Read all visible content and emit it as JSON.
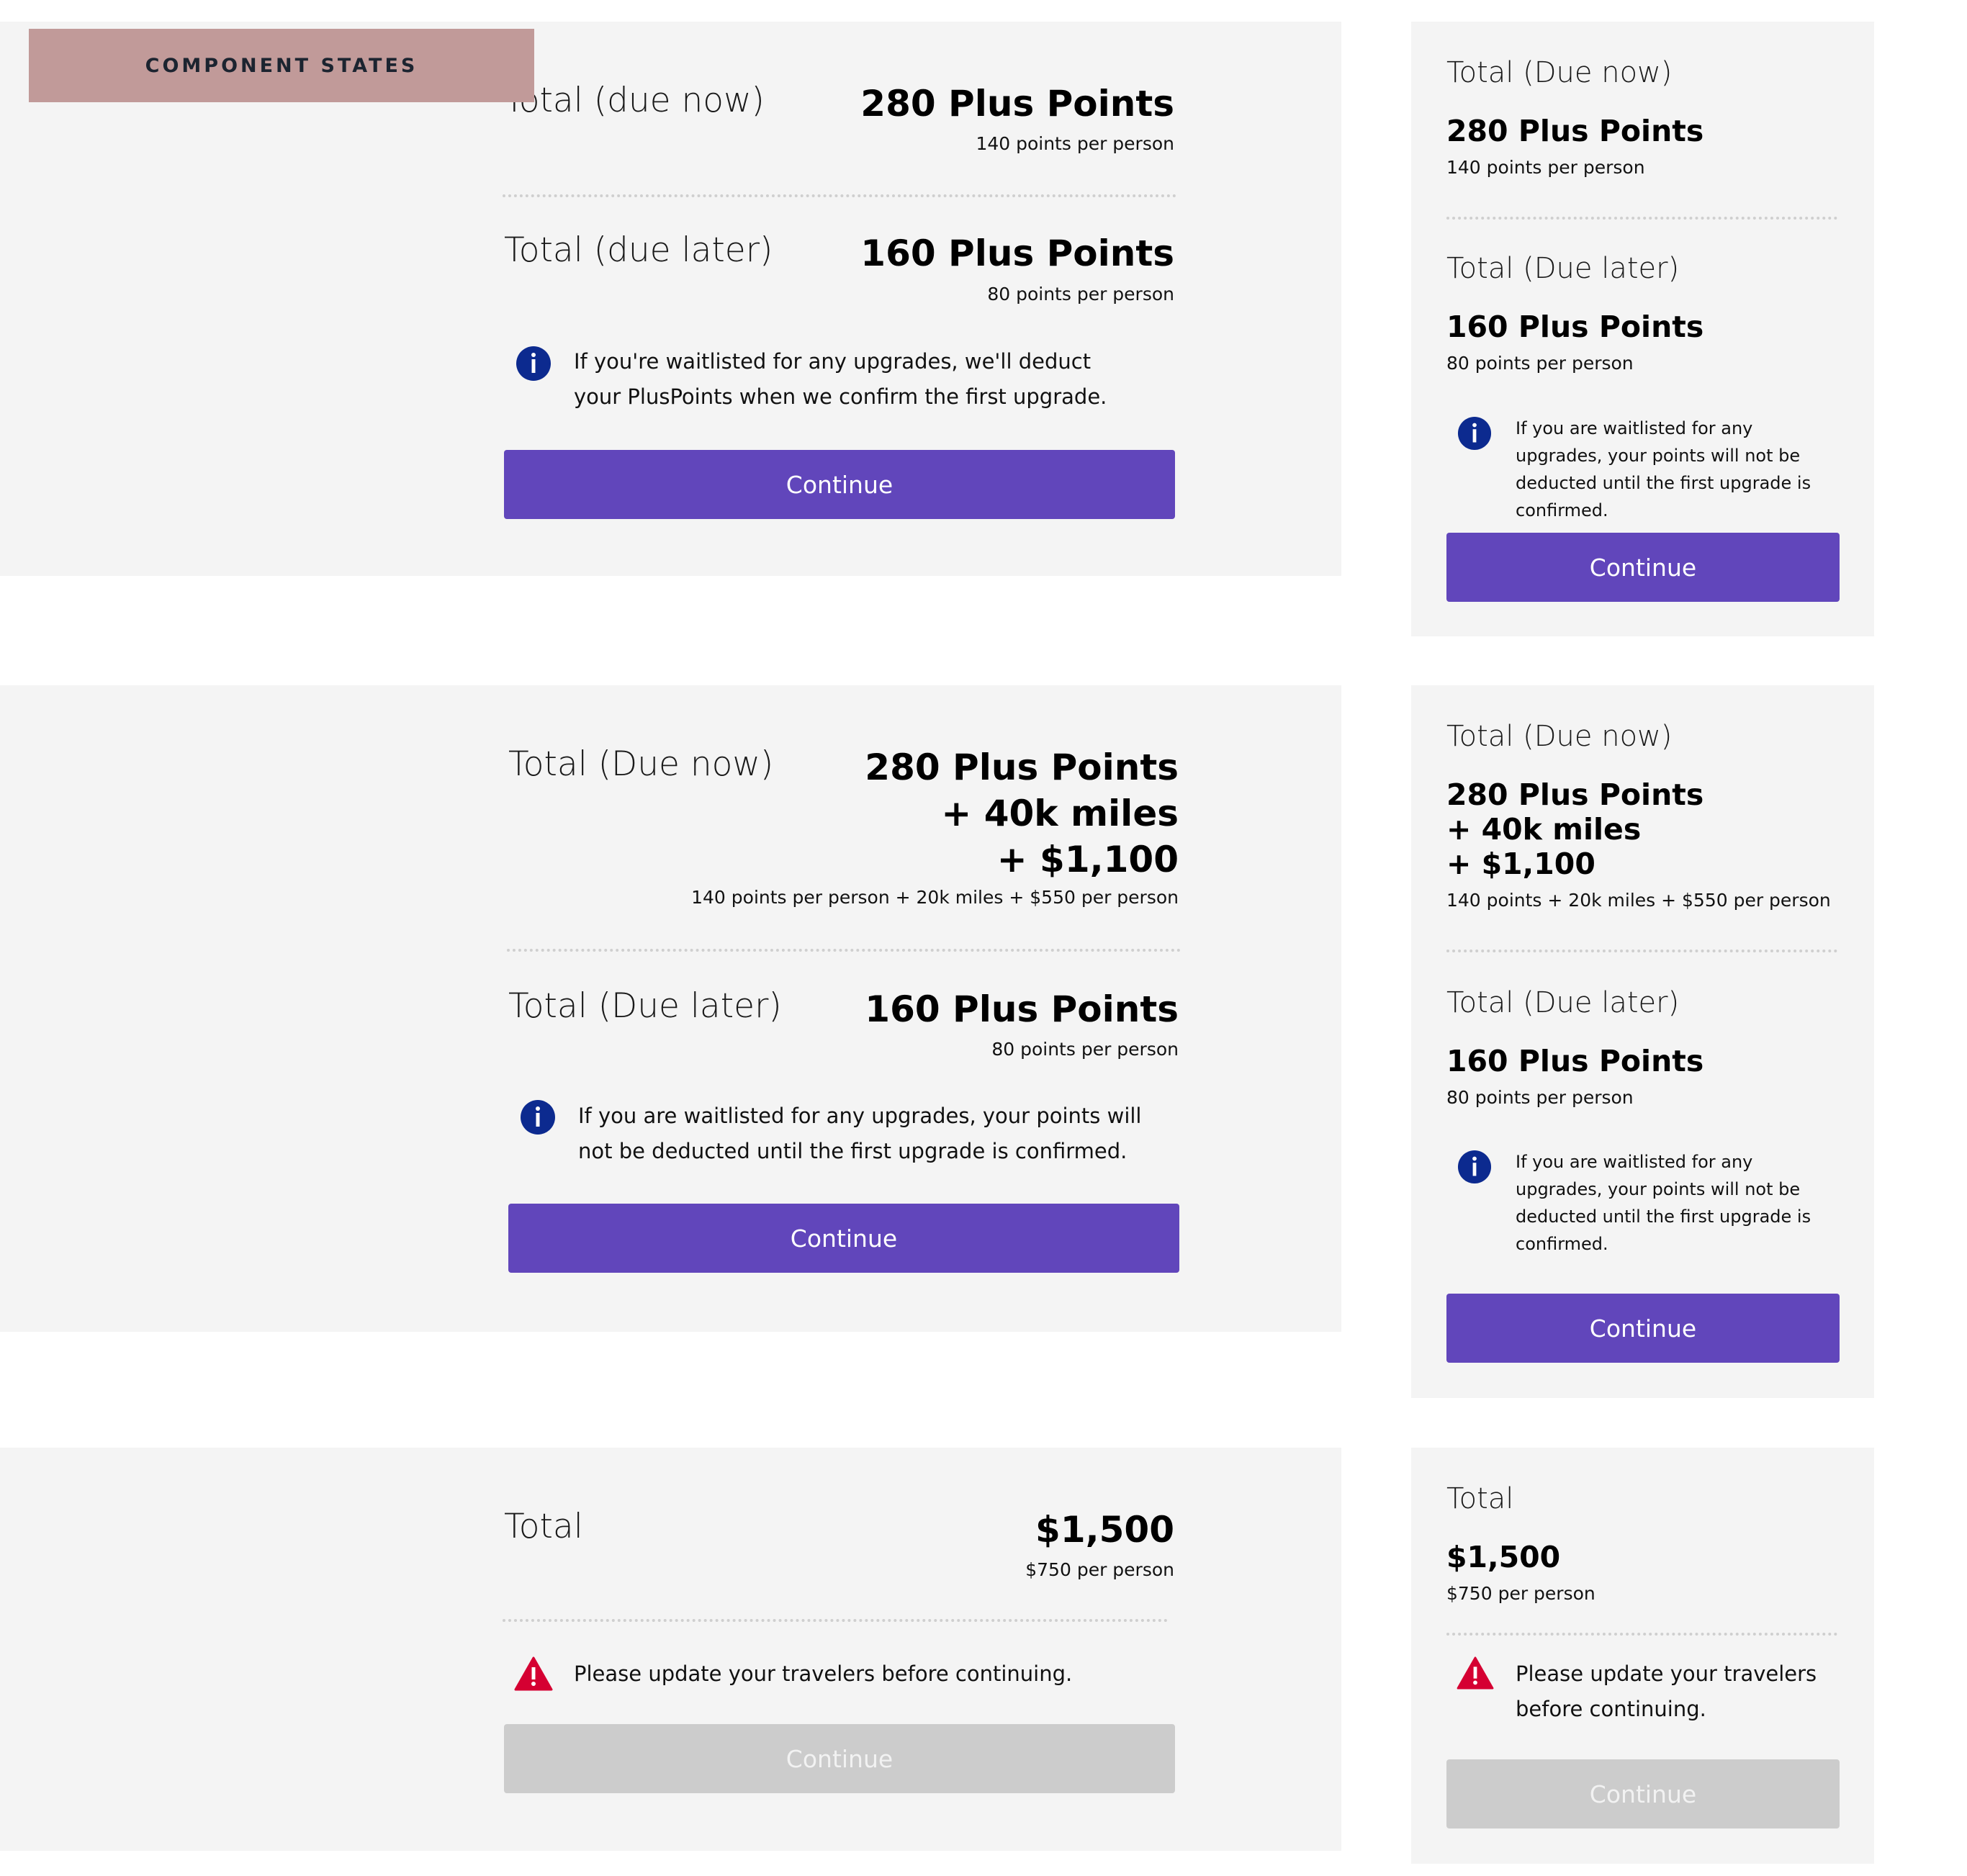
{
  "header": {
    "label": "COMPONENT STATES"
  },
  "state1_wide": {
    "due_now_label": "Total (due now)",
    "due_now_amount": "280 Plus Points",
    "due_now_sub": "140 points per person",
    "due_later_label": "Total (due later)",
    "due_later_amount": "160 Plus Points",
    "due_later_sub": "80 points per person",
    "info_text": "If you're waitlisted for any upgrades, we'll deduct your PlusPoints when we confirm the first upgrade.",
    "button_label": "Continue"
  },
  "state1_narrow": {
    "due_now_label": "Total (Due now)",
    "due_now_amount": "280 Plus Points",
    "due_now_sub": "140 points per person",
    "due_later_label": "Total (Due later)",
    "due_later_amount": "160 Plus Points",
    "due_later_sub": "80 points per person",
    "info_text": "If you are waitlisted for any upgrades, your points will not be deducted until the first upgrade is confirmed.",
    "button_label": "Continue"
  },
  "state2_wide": {
    "due_now_label": "Total (Due now)",
    "due_now_line1": "280 Plus Points",
    "due_now_line2": "+ 40k miles",
    "due_now_line3": "+ $1,100",
    "due_now_sub": "140 points per person + 20k miles + $550 per person",
    "due_later_label": "Total (Due later)",
    "due_later_amount": "160 Plus Points",
    "due_later_sub": "80 points per person",
    "info_text": "If you are waitlisted for any upgrades, your points will not be deducted until the first upgrade is confirmed.",
    "button_label": "Continue"
  },
  "state2_narrow": {
    "due_now_label": "Total (Due now)",
    "due_now_line1": "280 Plus Points",
    "due_now_line2": "+ 40k miles",
    "due_now_line3": "+ $1,100",
    "due_now_sub": "140 points + 20k miles + $550 per person",
    "due_later_label": "Total (Due later)",
    "due_later_amount": "160 Plus Points",
    "due_later_sub": "80 points per person",
    "info_text": "If you are waitlisted for any upgrades, your points will not be deducted until the first upgrade is confirmed.",
    "button_label": "Continue"
  },
  "state3_wide": {
    "total_label": "Total",
    "total_amount": "$1,500",
    "total_sub": "$750 per person",
    "warning_text": "Please update your travelers before continuing.",
    "button_label": "Continue"
  },
  "state3_narrow": {
    "total_label": "Total",
    "total_amount": "$1,500",
    "total_sub": "$750 per person",
    "warning_text": "Please update your travelers before continuing.",
    "button_label": "Continue"
  },
  "colors": {
    "panel_bg": "#f4f4f4",
    "label_bg": "#c19a99",
    "primary_button": "#6146bb",
    "disabled_button": "#cccccc",
    "info_icon": "#0c2a8f",
    "warning_icon": "#d50032"
  },
  "icons": {
    "info": "info-circle-icon",
    "warning": "warning-triangle-icon"
  }
}
